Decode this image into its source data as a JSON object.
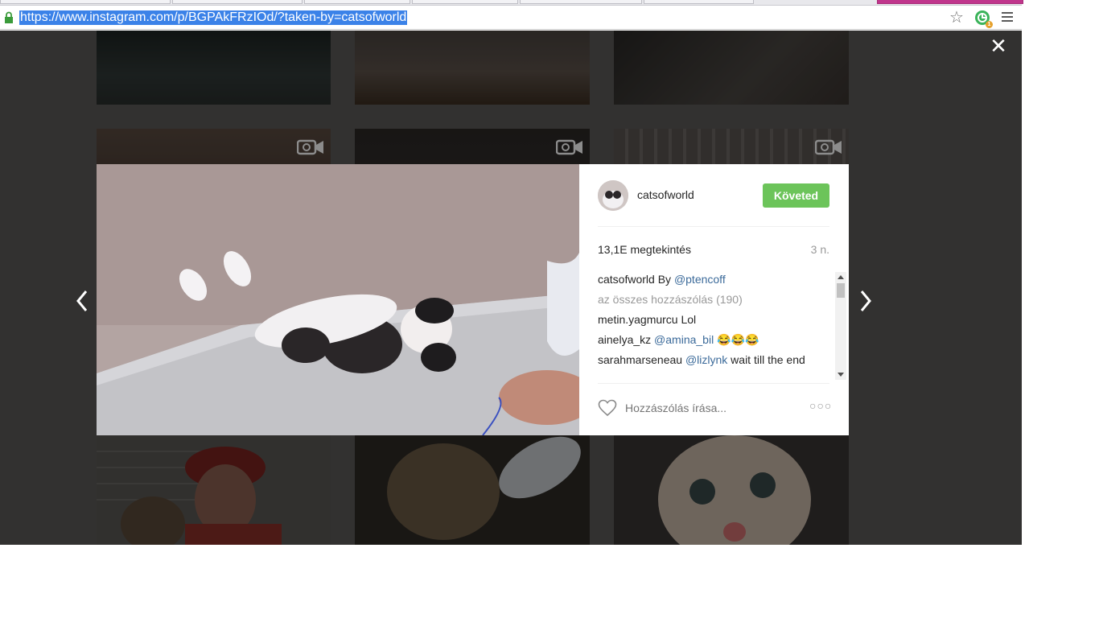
{
  "browser": {
    "url": "https://www.instagram.com/p/BGPAkFRzIOd/?taken-by=catsofworld",
    "extension_badge": "1"
  },
  "icons": {
    "lock": "lock-icon",
    "bookmark": "star-icon",
    "extension": "extension-icon",
    "menu": "hamburger-menu-icon",
    "close": "close-icon",
    "prev": "chevron-left-icon",
    "next": "chevron-right-icon",
    "video": "video-camera-icon",
    "like": "heart-icon",
    "options": "ellipsis-icon"
  },
  "post": {
    "username": "catsofworld",
    "follow_label": "Követed",
    "views": "13,1E megtekintés",
    "age": "3 n.",
    "comments": [
      {
        "user": "catsofworld",
        "text": " By ",
        "mention": "@ptencoff"
      },
      {
        "all_label": "az összes hozzászólás (190)"
      },
      {
        "user": "metin.yagmurcu",
        "text": " Lol"
      },
      {
        "user": "ainelya_kz",
        "mention": " @amina_bil",
        "text": " 😂😂😂"
      },
      {
        "user": "sarahmarseneau",
        "mention": " @lizlynk",
        "text": " wait till the end"
      }
    ],
    "comment_placeholder": "Hozzászólás írása...",
    "more_label": "○○○"
  },
  "colors": {
    "follow_green": "#6cc45a",
    "url_highlight": "#3b82e8",
    "mention_blue": "#3b6a9a",
    "overlay": "#5c5a58"
  }
}
